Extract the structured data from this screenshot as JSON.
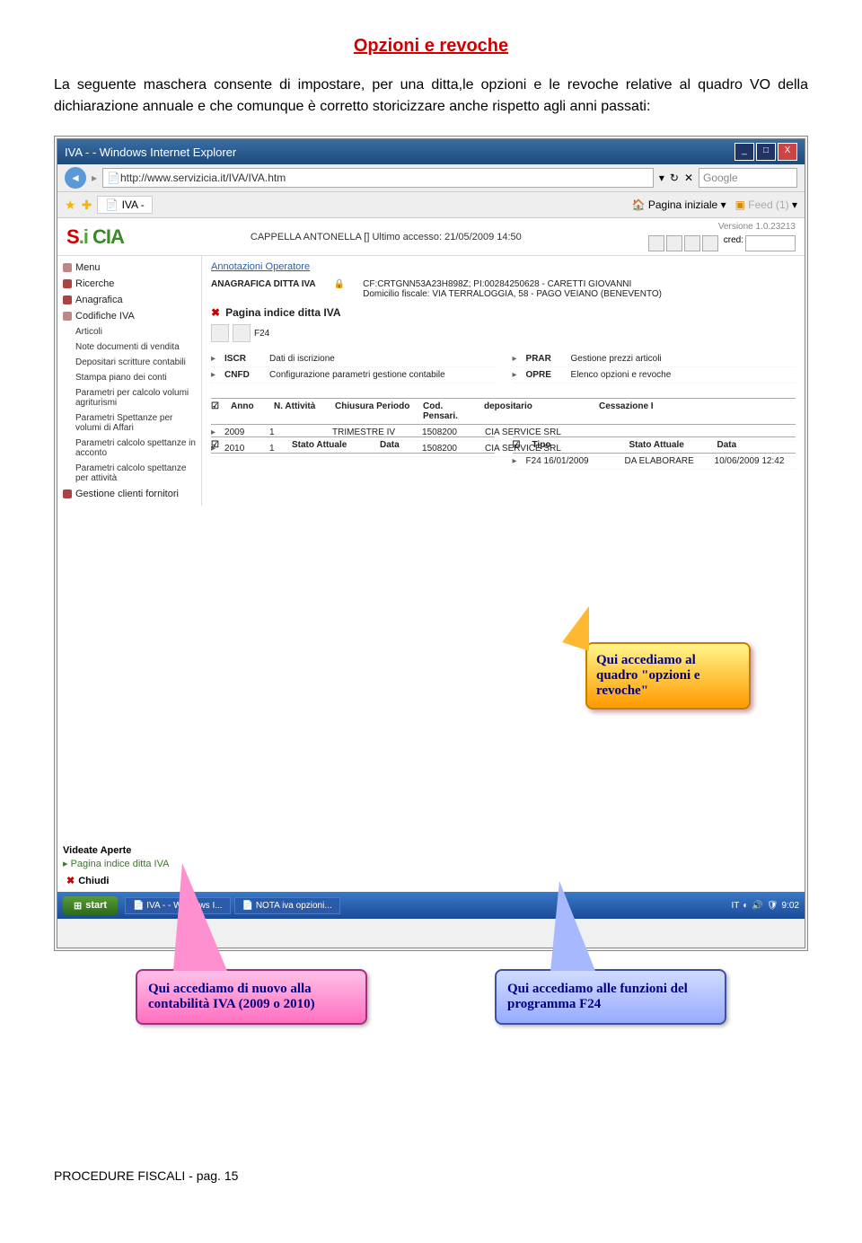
{
  "doc": {
    "title": "Opzioni e revoche",
    "intro": "La seguente maschera consente di impostare, per una ditta,le opzioni e le revoche relative al quadro VO della dichiarazione annuale e che comunque è corretto storicizzare anche rispetto agli anni passati:",
    "footer": "PROCEDURE FISCALI - pag. 15"
  },
  "window": {
    "title": "IVA - - Windows Internet Explorer",
    "url": "http://www.servizicia.it/IVA/IVA.htm",
    "search_placeholder": "Google",
    "tab": "IVA -",
    "pagina_iniziale": "Pagina iniziale",
    "feed": "Feed (1)"
  },
  "app": {
    "logo": "S.i CIA",
    "userline": "CAPPELLA ANTONELLA [] Ultimo accesso: 21/05/2009 14:50",
    "version": "Versione 1.0.23213",
    "cred": "cred:"
  },
  "sidebar": {
    "menu": "Menu",
    "ricerche": "Ricerche",
    "anagrafica": "Anagrafica",
    "codifiche": "Codifiche IVA",
    "subs": [
      "Articoli",
      "Note documenti di vendita",
      "Depositari scritture contabili",
      "Stampa piano dei conti",
      "Parametri per calcolo volumi agriturismi",
      "Parametri Spettanze per volumi di Affari",
      "Parametri calcolo spettanze in acconto",
      "Parametri calcolo spettanze per attività"
    ],
    "gestione": "Gestione clienti fornitori",
    "videate": "Videate Aperte",
    "pagina_aperta": "Pagina indice ditta IVA",
    "chiudi": "Chiudi"
  },
  "main": {
    "annotazioni": "Annotazioni Operatore",
    "anag_label": "ANAGRAFICA DITTA IVA",
    "anag_cf": "CF:CRTGNN53A23H898Z; PI:00284250628 - CARETTI GIOVANNI",
    "anag_dom": "Domicilio fiscale: VIA TERRALOGGIA, 58 - PAGO VEIANO (BENEVENTO)",
    "pag_title": "Pagina indice ditta IVA",
    "f24": "F24",
    "left_rows": [
      {
        "code": "ISCR",
        "desc": "Dati di iscrizione"
      },
      {
        "code": "CNFD",
        "desc": "Configurazione parametri gestione contabile"
      }
    ],
    "right_rows": [
      {
        "code": "PRAR",
        "desc": "Gestione prezzi articoli"
      },
      {
        "code": "OPRE",
        "desc": "Elenco opzioni e revoche"
      }
    ],
    "thead": [
      "Anno",
      "N. Attività",
      "Chiusura Periodo",
      "Cod. Pensari.",
      "depositario",
      "Cessazione I"
    ],
    "data_rows": [
      {
        "anno": "2009",
        "natt": "1",
        "chius": "TRIMESTRE IV",
        "cod": "1508200",
        "dep": "CIA SERVICE SRL",
        "cess": ""
      },
      {
        "anno": "2010",
        "natt": "1",
        "chius": "",
        "cod": "1508200",
        "dep": "CIA SERVICE SRL",
        "cess": ""
      }
    ],
    "bt_head1": [
      "",
      "Stato Attuale",
      "Data"
    ],
    "bt_head2": [
      "Tipo",
      "Stato Attuale",
      "Data"
    ],
    "bt_row": [
      "F24 16/01/2009",
      "DA ELABORARE",
      "10/06/2009 12:42"
    ]
  },
  "callouts": {
    "yellow": "Qui accediamo al quadro \"opzioni e revoche\"",
    "pink": "Qui accediamo di nuovo alla contabilità IVA (2009 o 2010)",
    "blue": "Qui accediamo alle funzioni del programma F24"
  },
  "taskbar": {
    "start": "start",
    "tasks": [
      "IVA - - Windows I...",
      "NOTA iva opzioni..."
    ],
    "lang": "IT",
    "time": "9:02"
  }
}
